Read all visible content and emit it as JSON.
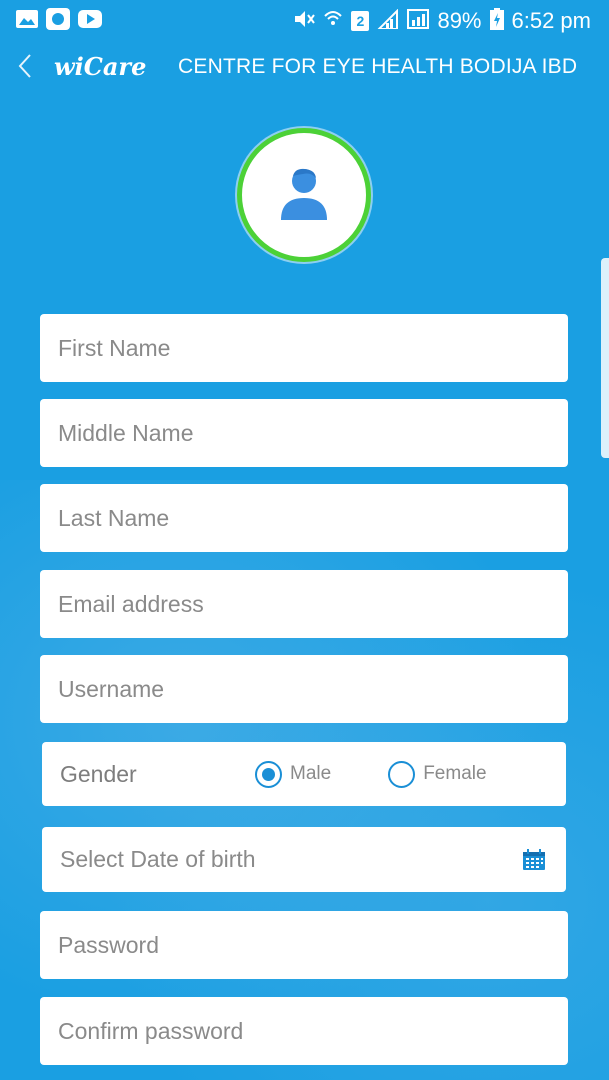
{
  "status_bar": {
    "battery": "89%",
    "time": "6:52 pm",
    "sim_badge": "2"
  },
  "app_bar": {
    "brand": "wiCare",
    "title": "CENTRE FOR EYE HEALTH BODIJA IBD"
  },
  "form": {
    "first_name": {
      "placeholder": "First Name",
      "value": ""
    },
    "middle_name": {
      "placeholder": "Middle Name",
      "value": ""
    },
    "last_name": {
      "placeholder": "Last Name",
      "value": ""
    },
    "email": {
      "placeholder": "Email address",
      "value": ""
    },
    "username": {
      "placeholder": "Username",
      "value": ""
    },
    "gender": {
      "label": "Gender",
      "options": [
        "Male",
        "Female"
      ],
      "selected": "Male"
    },
    "dob": {
      "placeholder": "Select Date of birth",
      "value": ""
    },
    "password": {
      "placeholder": "Password",
      "value": ""
    },
    "confirm_password": {
      "placeholder": "Confirm password",
      "value": ""
    }
  },
  "colors": {
    "background": "#1a9fe2",
    "avatar_ring": "#4cd137",
    "accent": "#1a8fd6"
  },
  "icons": [
    "gallery-icon",
    "app-icon",
    "youtube-icon",
    "mute-icon",
    "wifi-icon",
    "signal-icon",
    "battery-icon",
    "back-arrow-icon",
    "user-avatar-icon",
    "calendar-icon"
  ]
}
